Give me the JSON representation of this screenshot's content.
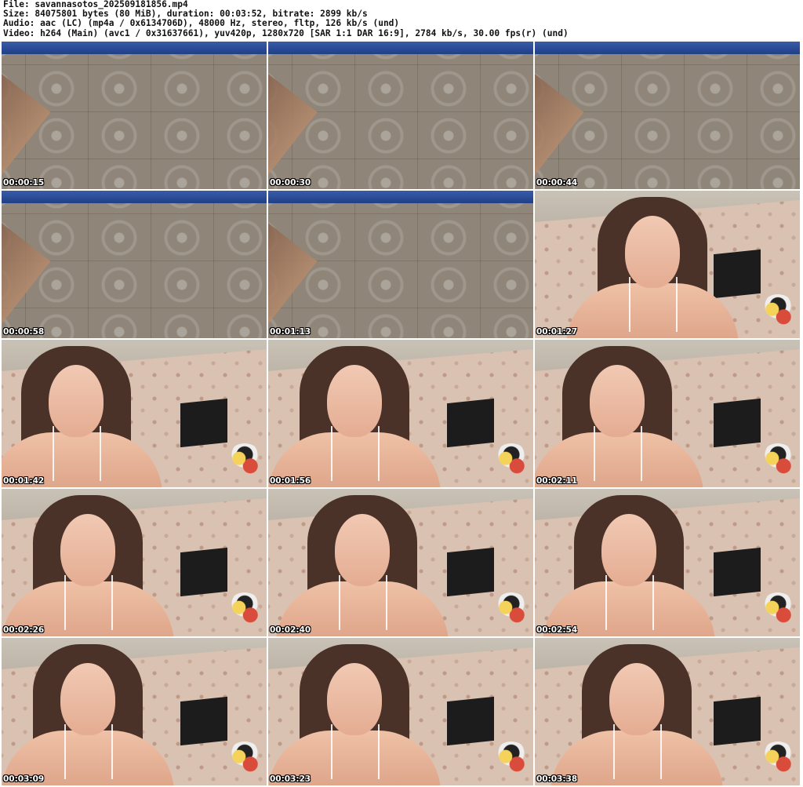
{
  "header": {
    "file_line": "File: savannasotos_202509181856.mp4",
    "size_line": "Size: 84075801 bytes (80 MiB), duration: 00:03:52, bitrate: 2899 kb/s",
    "audio_line": "Audio: aac (LC) (mp4a / 0x6134706D), 48000 Hz, stereo, fltp, 126 kb/s (und)",
    "video_line": "Video: h264 (Main) (avc1 / 0x31637661), yuv420p, 1280x720 [SAR 1:1 DAR 16:9], 2784 kb/s, 30.00 fps(r) (und)"
  },
  "thumbnails": [
    {
      "timestamp": "00:00:15",
      "scene": "ceiling"
    },
    {
      "timestamp": "00:00:30",
      "scene": "ceiling"
    },
    {
      "timestamp": "00:00:44",
      "scene": "ceiling"
    },
    {
      "timestamp": "00:00:58",
      "scene": "ceiling"
    },
    {
      "timestamp": "00:01:13",
      "scene": "ceiling"
    },
    {
      "timestamp": "00:01:27",
      "scene": "room"
    },
    {
      "timestamp": "00:01:42",
      "scene": "room"
    },
    {
      "timestamp": "00:01:56",
      "scene": "room"
    },
    {
      "timestamp": "00:02:11",
      "scene": "room"
    },
    {
      "timestamp": "00:02:26",
      "scene": "room"
    },
    {
      "timestamp": "00:02:40",
      "scene": "room"
    },
    {
      "timestamp": "00:02:54",
      "scene": "room"
    },
    {
      "timestamp": "00:03:09",
      "scene": "room"
    },
    {
      "timestamp": "00:03:23",
      "scene": "room"
    },
    {
      "timestamp": "00:03:38",
      "scene": "room"
    }
  ]
}
